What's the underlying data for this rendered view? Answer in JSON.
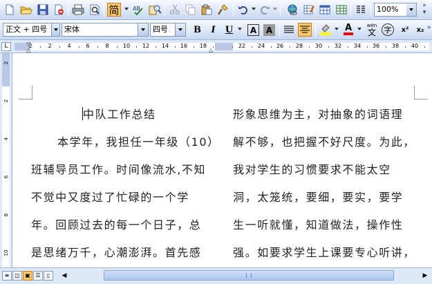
{
  "toolbar_standard": {
    "chinese_mode_label": "简",
    "zoom_value": "100%",
    "buttons": [
      "new-icon",
      "open-icon",
      "save-icon",
      "permission-icon",
      "print-icon",
      "print-preview-icon",
      "spelling-icon",
      "research-icon",
      "cut-icon",
      "copy-icon",
      "paste-icon",
      "format-painter-icon",
      "undo-icon",
      "redo-icon",
      "hyperlink-icon",
      "tables-borders-icon",
      "insert-table-icon",
      "insert-excel-icon",
      "columns-icon"
    ]
  },
  "toolbar_formatting": {
    "style_value": "正文 + 四号",
    "font_value": "宋体",
    "size_value": "四号",
    "bold_label": "B",
    "italic_label": "I",
    "underline_label": "U",
    "char_border_label": "A",
    "char_shading_label": "A",
    "phonetic_label": "文",
    "phonetic_top_label": "wén",
    "enclose_label": "字",
    "superscript_label": "x²",
    "subscript_label": "x₂",
    "colors": {
      "highlight": "#ffff00",
      "font_color": "#ff0000",
      "active_button": "#ffc96b"
    }
  },
  "ruler": {
    "corner_label": "L",
    "numbers": [
      "2",
      "2",
      "4",
      "6",
      "8",
      "10",
      "12",
      "14",
      "16",
      "18",
      "",
      "22",
      "24",
      "26",
      "28",
      "30",
      "32",
      "34",
      "36",
      "38",
      "40"
    ],
    "vertical_numbers": [
      "2",
      "2",
      "4",
      "6",
      "8",
      "10"
    ]
  },
  "document": {
    "left_column": [
      "中队工作总结",
      "本学年，我担任一年级（10）",
      "班辅导员工作。时间像流水,不知",
      "不觉中又度过了忙碌的一个学",
      "年。回顾过去的每一个日子，总",
      "是思绪万千，心潮澎湃。首先感"
    ],
    "right_column": [
      "形象思维为主，对抽象的词语理",
      "解不够，也把握不好尺度。为此，",
      "我对学生的习惯要求不能太空",
      "洞，太笼统，要细，要实，要学",
      "生一听就懂，知道做法，操作性",
      "强。如要求学生上课要专心听讲，"
    ]
  }
}
